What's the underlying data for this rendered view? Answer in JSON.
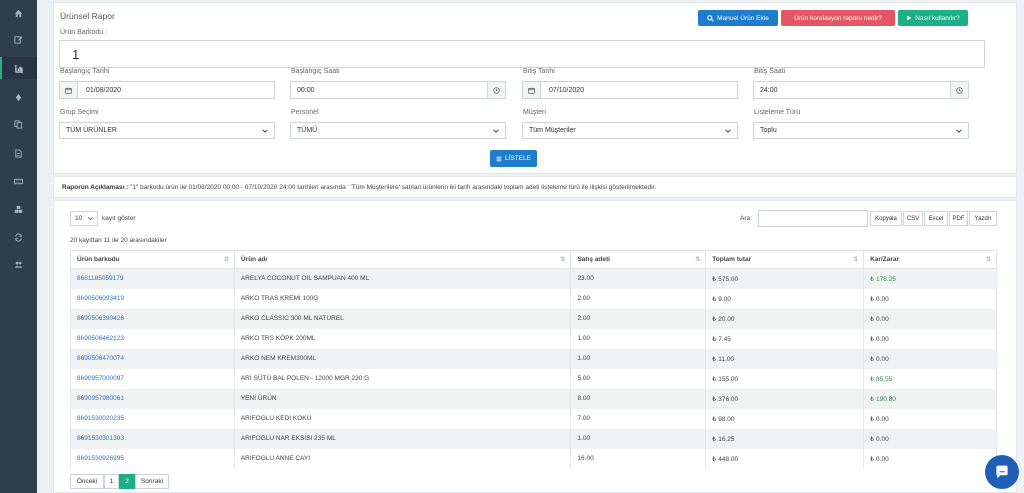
{
  "report": {
    "title": "Ürünsel Rapor",
    "buttons": {
      "manual_add": "Manuel Ürün Ekle",
      "correlation": "Ürün korelasyon raporu nedir?",
      "how_to": "Nasıl kullanılır?"
    },
    "barcode_label": "Ürün Barkodu :",
    "barcode_value": "1",
    "start_date_label": "Başlangıç Tarihi",
    "start_date": "01/08/2020",
    "start_time_label": "Başlangıç Saati",
    "start_time": "00:00",
    "end_date_label": "Bitiş Tarihi",
    "end_date": "07/10/2020",
    "end_time_label": "Bitiş Saati",
    "end_time": "24:00",
    "group_label": "Grup Seçimi",
    "group_value": "TÜM ÜRÜNLER",
    "staff_label": "Personel",
    "staff_value": "TÜMÜ",
    "customer_label": "Müşteri",
    "customer_value": "Tüm Müşteriler",
    "list_type_label": "Listeleme Türü",
    "list_type_value": "Toplu",
    "list_button": "LİSTELE"
  },
  "description": {
    "label": "Raporun Açıklaması :",
    "text": " \"1\" barkodu ürün ile 01/08/2020 00:00 - 07/10/2020 24:00 tarihleri arasında ' 'Tüm Müşterilere' satılan ürünlerin iki tarih arasındaki toplam adeti listeleme türü ile ilişkisi gösterilmektedir."
  },
  "table_controls": {
    "page_size": "10",
    "page_size_suffix": "kayıt göster",
    "search_label": "Ara:",
    "search_value": "",
    "export_buttons": [
      "Kopyala",
      "CSV",
      "Excel",
      "PDF",
      "Yazdır"
    ],
    "info": "20 kayıttan 11 ile 20 arasındakiler"
  },
  "table": {
    "headers": [
      "Ürün barkodu",
      "Ürün adı",
      "Satış adeti",
      "Toplam tutar",
      "Kar/Zarar"
    ],
    "rows": [
      {
        "code": "8681185059179",
        "name": "ARELYA COCONUT OIL SAMPUAN 400 ML",
        "qty": "23.00",
        "total": "₺ 575.00",
        "profit": "₺ 178.25",
        "pos": true
      },
      {
        "code": "8690506093419",
        "name": "ARKO TRAS KREMI 100G",
        "qty": "2.00",
        "total": "₺ 9.00",
        "profit": "₺ 0.00",
        "pos": false
      },
      {
        "code": "8690506390426",
        "name": "ARKO CLASSIC 300 ML NATUREL",
        "qty": "2.00",
        "total": "₺ 20.00",
        "profit": "₺ 0.00",
        "pos": false
      },
      {
        "code": "8690506462123",
        "name": "ARKO TRS KÖPK 200ML",
        "qty": "1.00",
        "total": "₺ 7.45",
        "profit": "₺ 0.00",
        "pos": false
      },
      {
        "code": "8690506470074",
        "name": "ARKO NEM KREM300ML",
        "qty": "1.00",
        "total": "₺ 11.00",
        "profit": "₺ 0.00",
        "pos": false
      },
      {
        "code": "8690957000097",
        "name": "ARI SÜTÜ BAL POLEN - 12000 MGR 230 G",
        "qty": "5.00",
        "total": "₺ 155.00",
        "profit": "₺ 85.55",
        "pos": true
      },
      {
        "code": "8690957980061",
        "name": "YENİ ÜRÜN",
        "qty": "8.00",
        "total": "₺ 376.00",
        "profit": "₺ 190.80",
        "pos": true
      },
      {
        "code": "8691530020235",
        "name": "ARIFOGLU KEDI KOKU",
        "qty": "7.00",
        "total": "₺ 98.00",
        "profit": "₺ 0.00",
        "pos": false
      },
      {
        "code": "8691530301303",
        "name": "ARIFOGLU NAR EKSISI 235 ML",
        "qty": "1.00",
        "total": "₺ 16.25",
        "profit": "₺ 0.00",
        "pos": false
      },
      {
        "code": "8691530926995",
        "name": "ARIFOGLU ANNE CAYI",
        "qty": "16.00",
        "total": "₺ 448.00",
        "profit": "₺ 0.00",
        "pos": false
      }
    ]
  },
  "pagination": {
    "prev": "Önceki",
    "pages": [
      "1",
      "2"
    ],
    "current": "2",
    "next": "Sonraki"
  },
  "sidebar": {
    "items": [
      "home-icon",
      "edit-icon",
      "chart-icon",
      "gem-icon",
      "copy-icon",
      "file-icon",
      "keyboard-icon",
      "cubes-icon",
      "refresh-icon",
      "users-icon"
    ],
    "active": "chart-icon"
  },
  "colors": {
    "sidebar": "#2f3d4f",
    "accent_green": "#1db087",
    "accent_blue": "#1f7ccc",
    "accent_red": "#e45566",
    "link": "#2a75c4",
    "profit": "#2f8a43"
  }
}
